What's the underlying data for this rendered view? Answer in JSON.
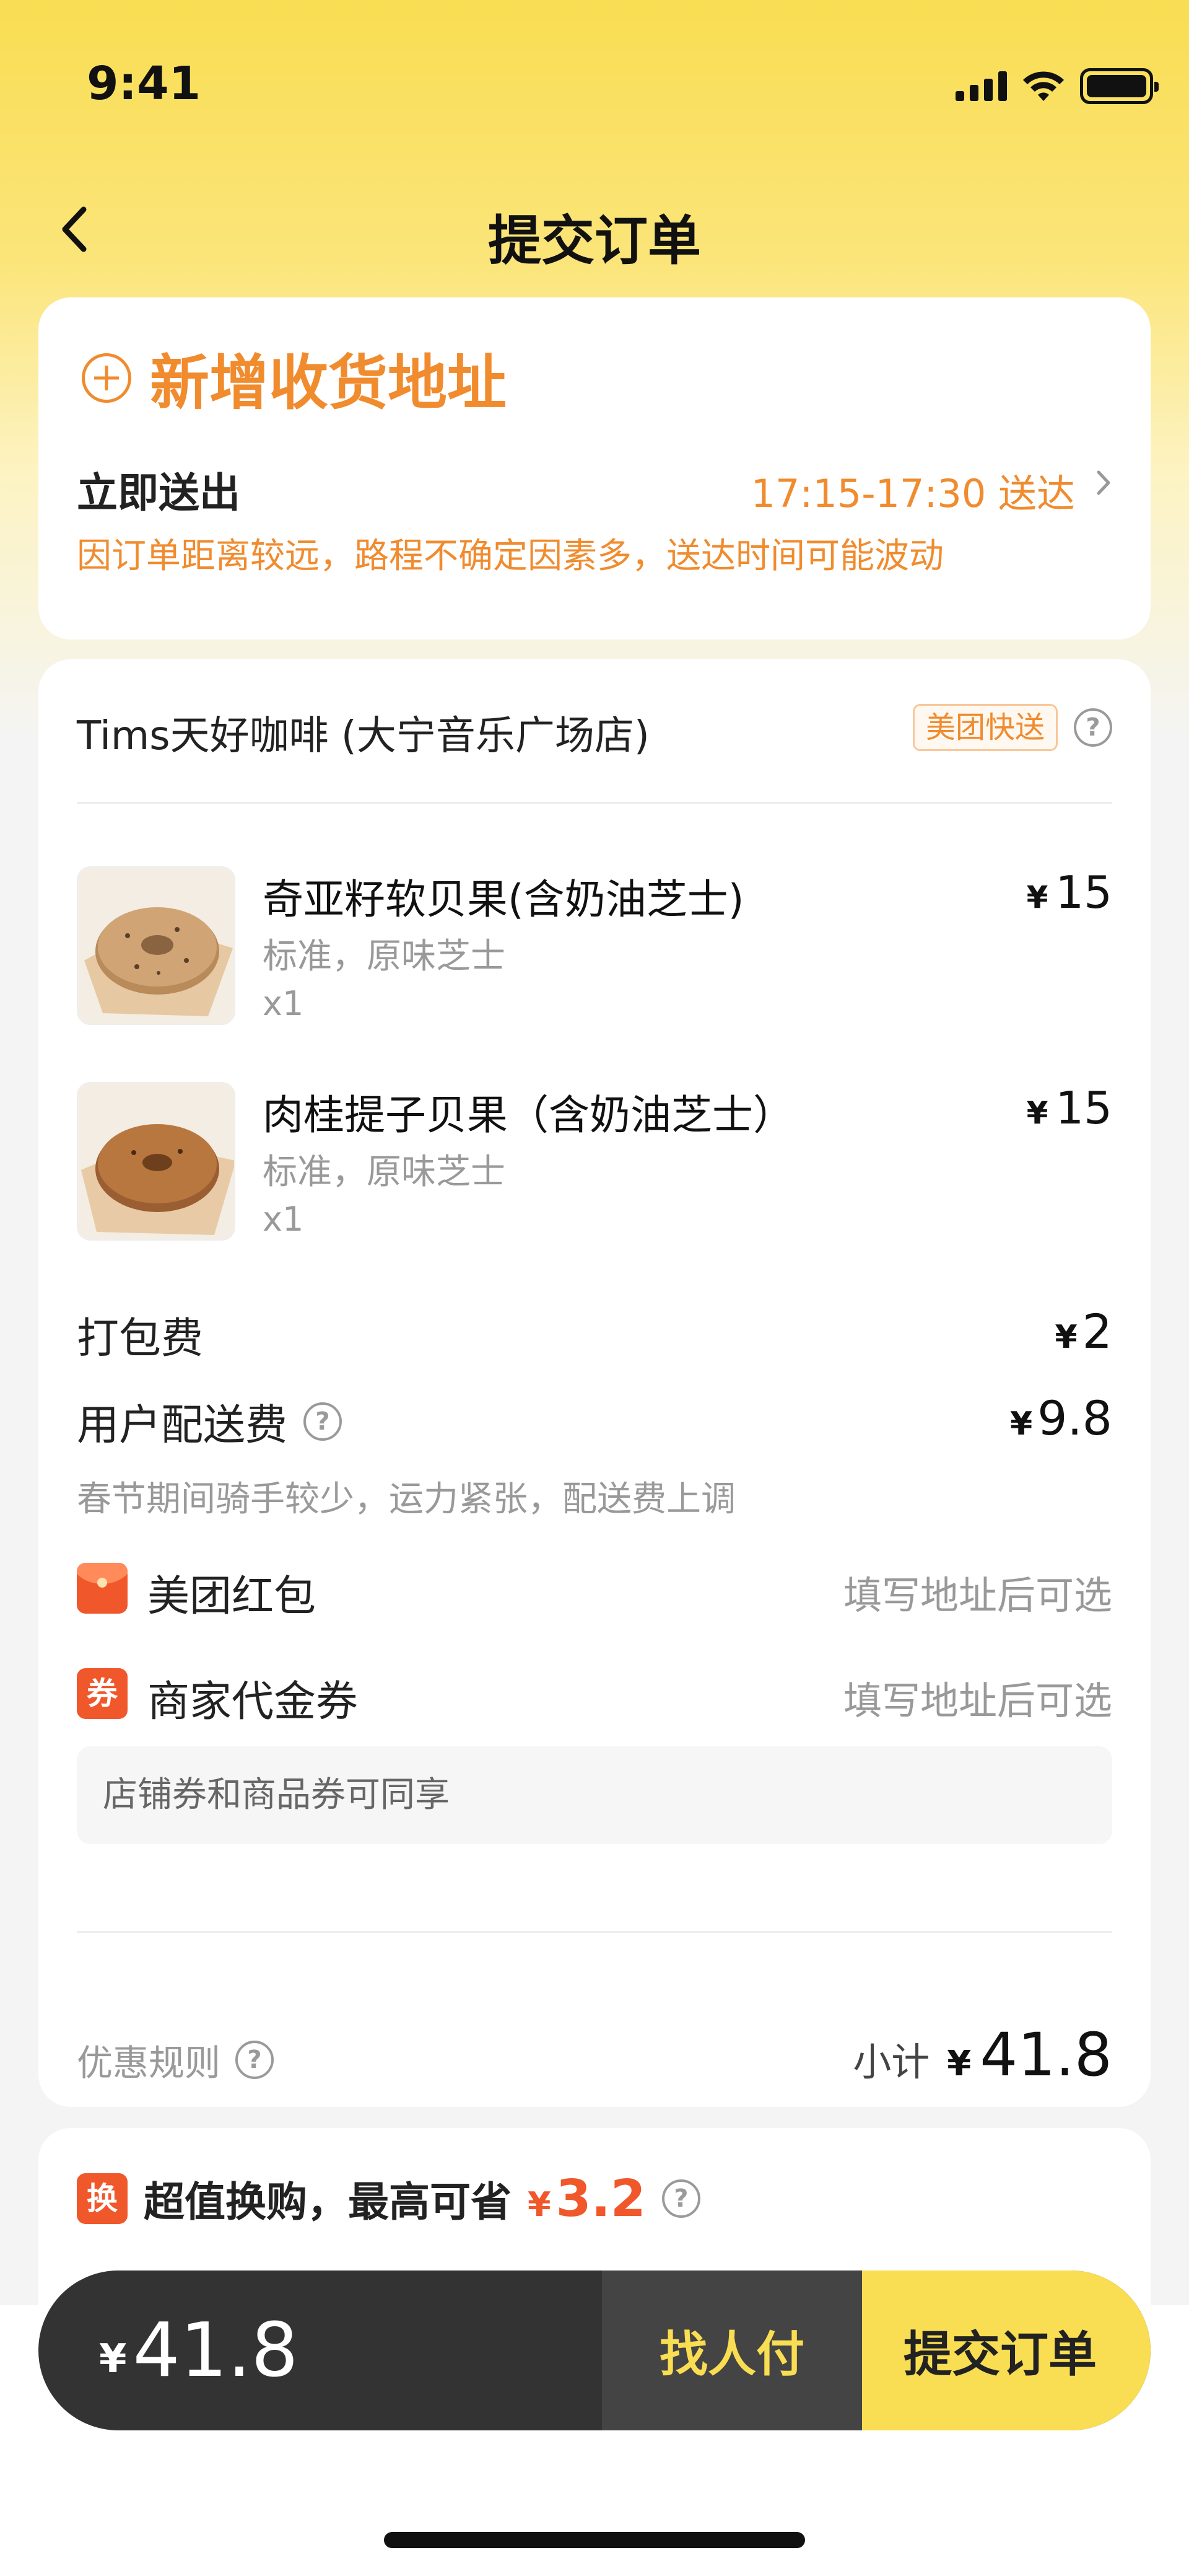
{
  "status_bar": {
    "time": "9:41"
  },
  "nav": {
    "title": "提交订单"
  },
  "address": {
    "add_label": "新增收货地址",
    "deliver_now": "立即送出",
    "eta": "17:15-17:30 送达",
    "delay_note": "因订单距离较远，路程不确定因素多，送达时间可能波动"
  },
  "order": {
    "shop_name": "Tims天好咖啡 (大宁音乐广场店)",
    "delivery_tag": "美团快送",
    "items": [
      {
        "name": "奇亚籽软贝果(含奶油芝士)",
        "spec": "标准，原味芝士",
        "qty": "x1",
        "currency": "¥",
        "price": "15"
      },
      {
        "name": "肉桂提子贝果（含奶油芝士）",
        "spec": "标准，原味芝士",
        "qty": "x1",
        "currency": "¥",
        "price": "15"
      }
    ],
    "packing_fee": {
      "label": "打包费",
      "currency": "¥",
      "value": "2"
    },
    "delivery_fee": {
      "label": "用户配送费",
      "currency": "¥",
      "value": "9.8",
      "note": "春节期间骑手较少，运力紧张，配送费上调"
    },
    "coupons": [
      {
        "icon": "red-packet-icon",
        "label": "美团红包",
        "value": "填写地址后可选"
      },
      {
        "icon": "coupon-icon",
        "icon_text": "券",
        "label": "商家代金券",
        "value": "填写地址后可选"
      }
    ],
    "share_note": "店铺券和商品券可同享",
    "rules_label": "优惠规则",
    "subtotal_label": "小计",
    "subtotal_currency": "¥",
    "subtotal": "41.8"
  },
  "promo": {
    "icon_text": "换",
    "text": "超值换购，最高可省",
    "currency": "¥",
    "save": "3.2"
  },
  "paybar": {
    "currency": "¥",
    "total": "41.8",
    "friend_pay": "找人付",
    "submit": "提交订单"
  },
  "colors": {
    "accent_yellow": "#f9dd52",
    "accent_orange": "#f08b2e",
    "accent_red": "#f0572b",
    "dark_bar": "#333333"
  }
}
